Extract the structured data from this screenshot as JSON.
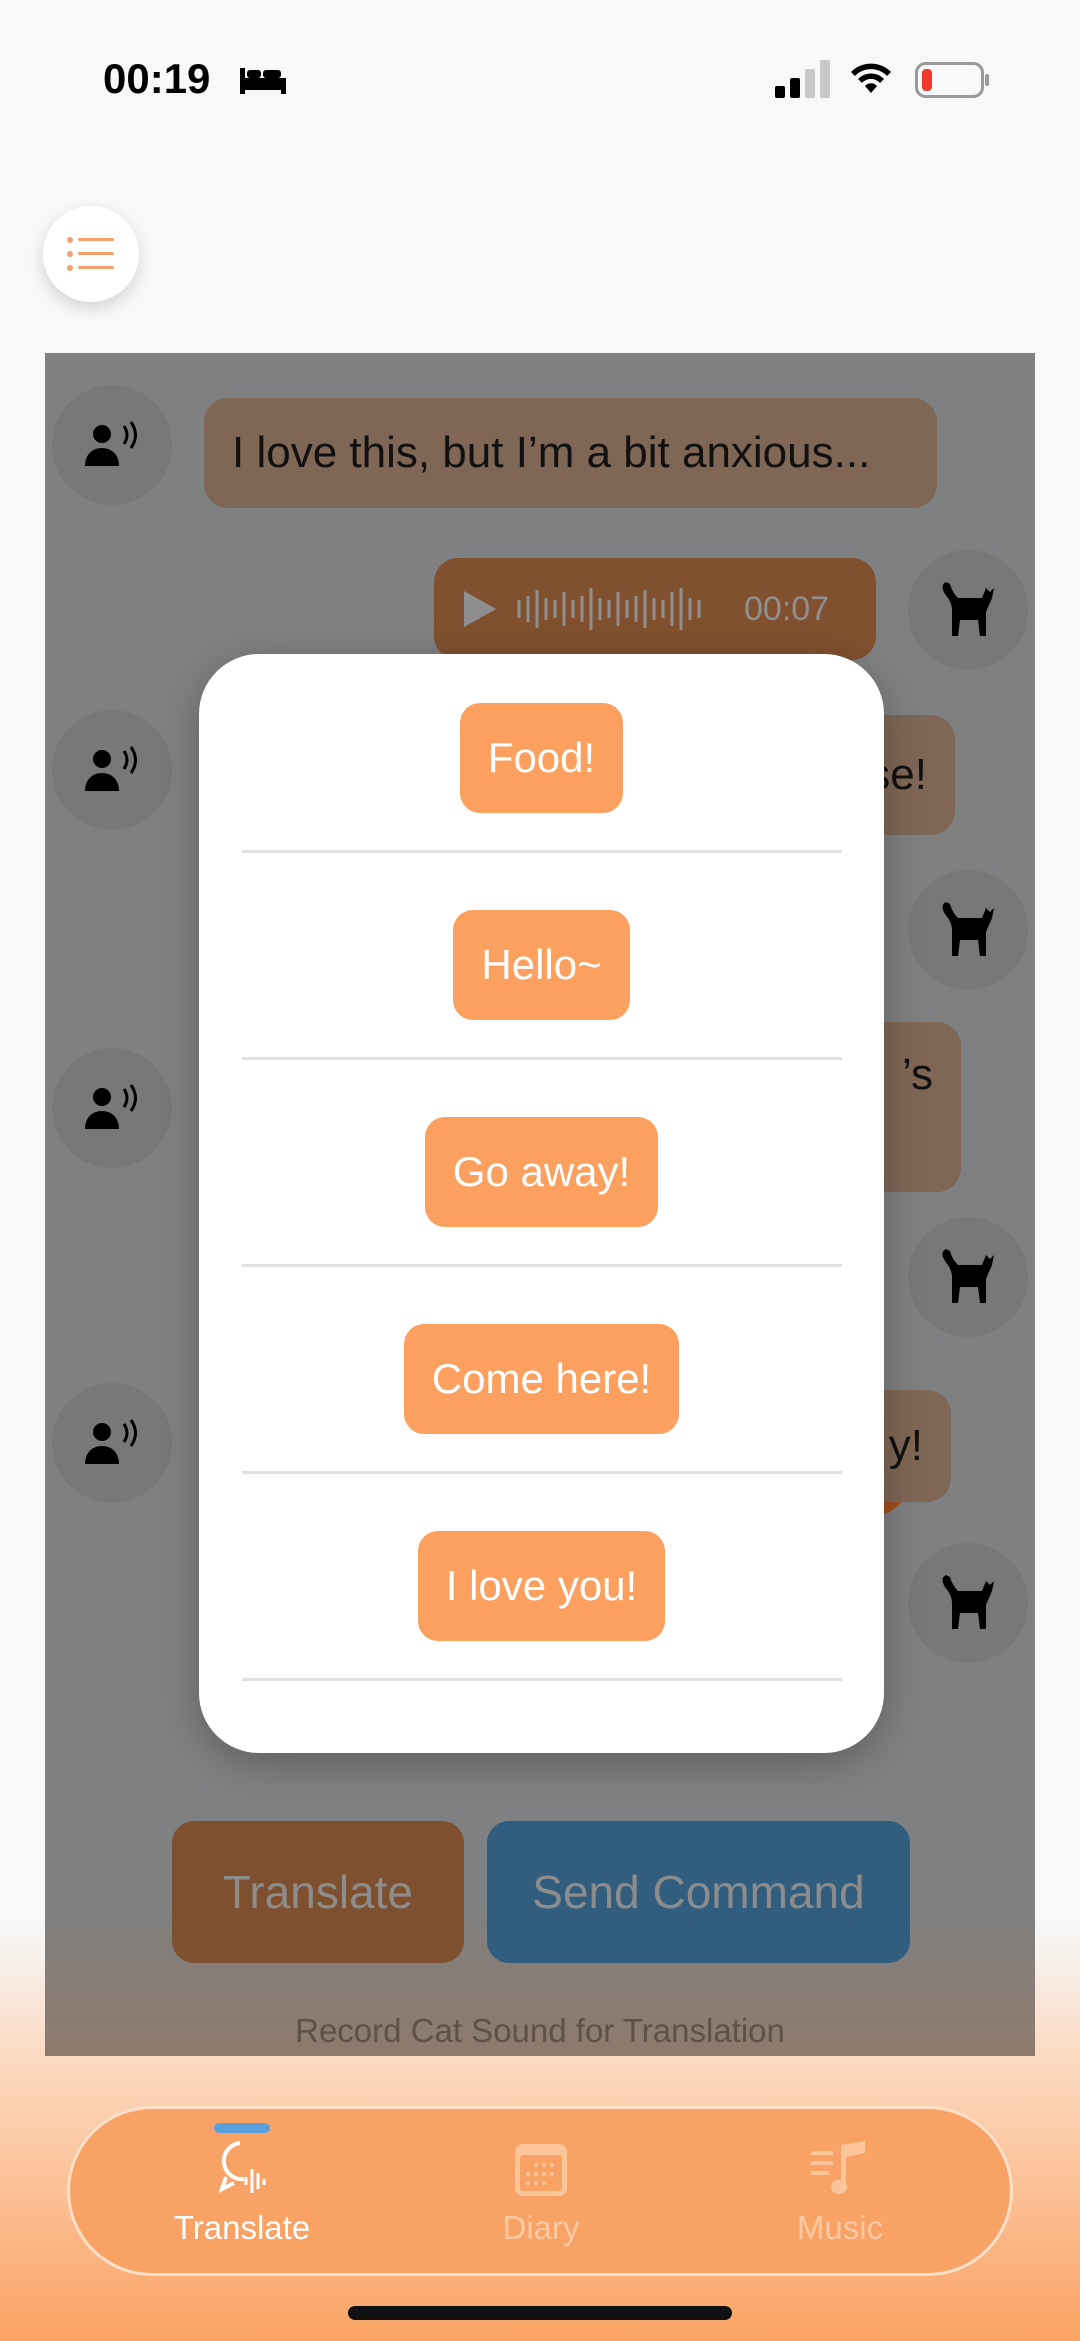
{
  "status_bar": {
    "time": "00:19",
    "icons": [
      "bed-icon",
      "cellular-signal-icon",
      "wifi-icon",
      "battery-low-icon"
    ]
  },
  "menu_button": {
    "icon": "list-icon"
  },
  "chat": {
    "messages": [
      {
        "sender": "user",
        "text": "I love this, but I’m a bit anxious..."
      },
      {
        "sender": "cat",
        "type": "audio",
        "duration": "00:07"
      },
      {
        "sender": "user",
        "text": "se!"
      },
      {
        "sender": "cat"
      },
      {
        "sender": "user",
        "text": "’s"
      },
      {
        "sender": "cat"
      },
      {
        "sender": "user",
        "text": "y!"
      },
      {
        "sender": "cat"
      }
    ]
  },
  "command_popup": {
    "options": [
      "Food!",
      "Hello~",
      "Go away!",
      "Come here!",
      "I love you!"
    ]
  },
  "actions": {
    "translate": "Translate",
    "send_command": "Send Command",
    "hint": "Record Cat Sound for Translation"
  },
  "tabbar": {
    "tabs": [
      {
        "label": "Translate",
        "icon": "speech-bubble-waveform-icon",
        "active": true
      },
      {
        "label": "Diary",
        "icon": "calendar-icon",
        "active": false
      },
      {
        "label": "Music",
        "icon": "music-list-icon",
        "active": false
      }
    ]
  },
  "colors": {
    "accent": "#fca060",
    "command_blue": "#4a90c8",
    "active_indicator": "#5aa0dc"
  }
}
